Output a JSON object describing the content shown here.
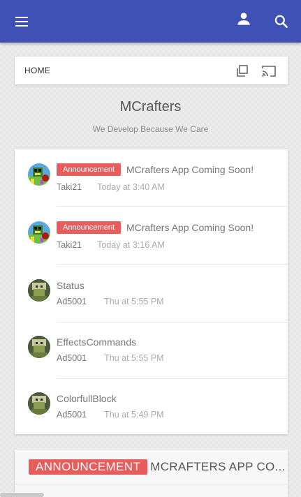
{
  "appbar": {
    "menu_icon": "hamburger-menu-icon",
    "user_icon": "user-icon",
    "search_icon": "search-icon",
    "color": "#3f51b5"
  },
  "breadcrumb": {
    "label": "HOME",
    "copy_icon": "copy-icon",
    "cast_icon": "cast-icon"
  },
  "site": {
    "title": "MCrafters",
    "tagline": "We Develop Because We Care"
  },
  "threads": [
    {
      "badge": "Announcement",
      "title": "MCrafters App Coming Soon!",
      "author": "Taki21",
      "time": "Today at 3:40 AM"
    },
    {
      "badge": "Announcement",
      "title": "MCrafters App Coming Soon!",
      "author": "Taki21",
      "time": "Today at 3:16 AM"
    },
    {
      "badge": "",
      "title": "Status",
      "author": "Ad5001",
      "time": "Thu at 5:55 PM"
    },
    {
      "badge": "",
      "title": "EffectsCommands",
      "author": "Ad5001",
      "time": "Thu at 5:55 PM"
    },
    {
      "badge": "",
      "title": "ColorfullBlock",
      "author": "Ad5001",
      "time": "Thu at 5:49 PM"
    }
  ],
  "featured": {
    "badge": "ANNOUNCEMENT",
    "title": "MCRAFTERS APP CO..."
  },
  "colors": {
    "badge": "#e85c5c",
    "accent": "#3f51b5"
  }
}
